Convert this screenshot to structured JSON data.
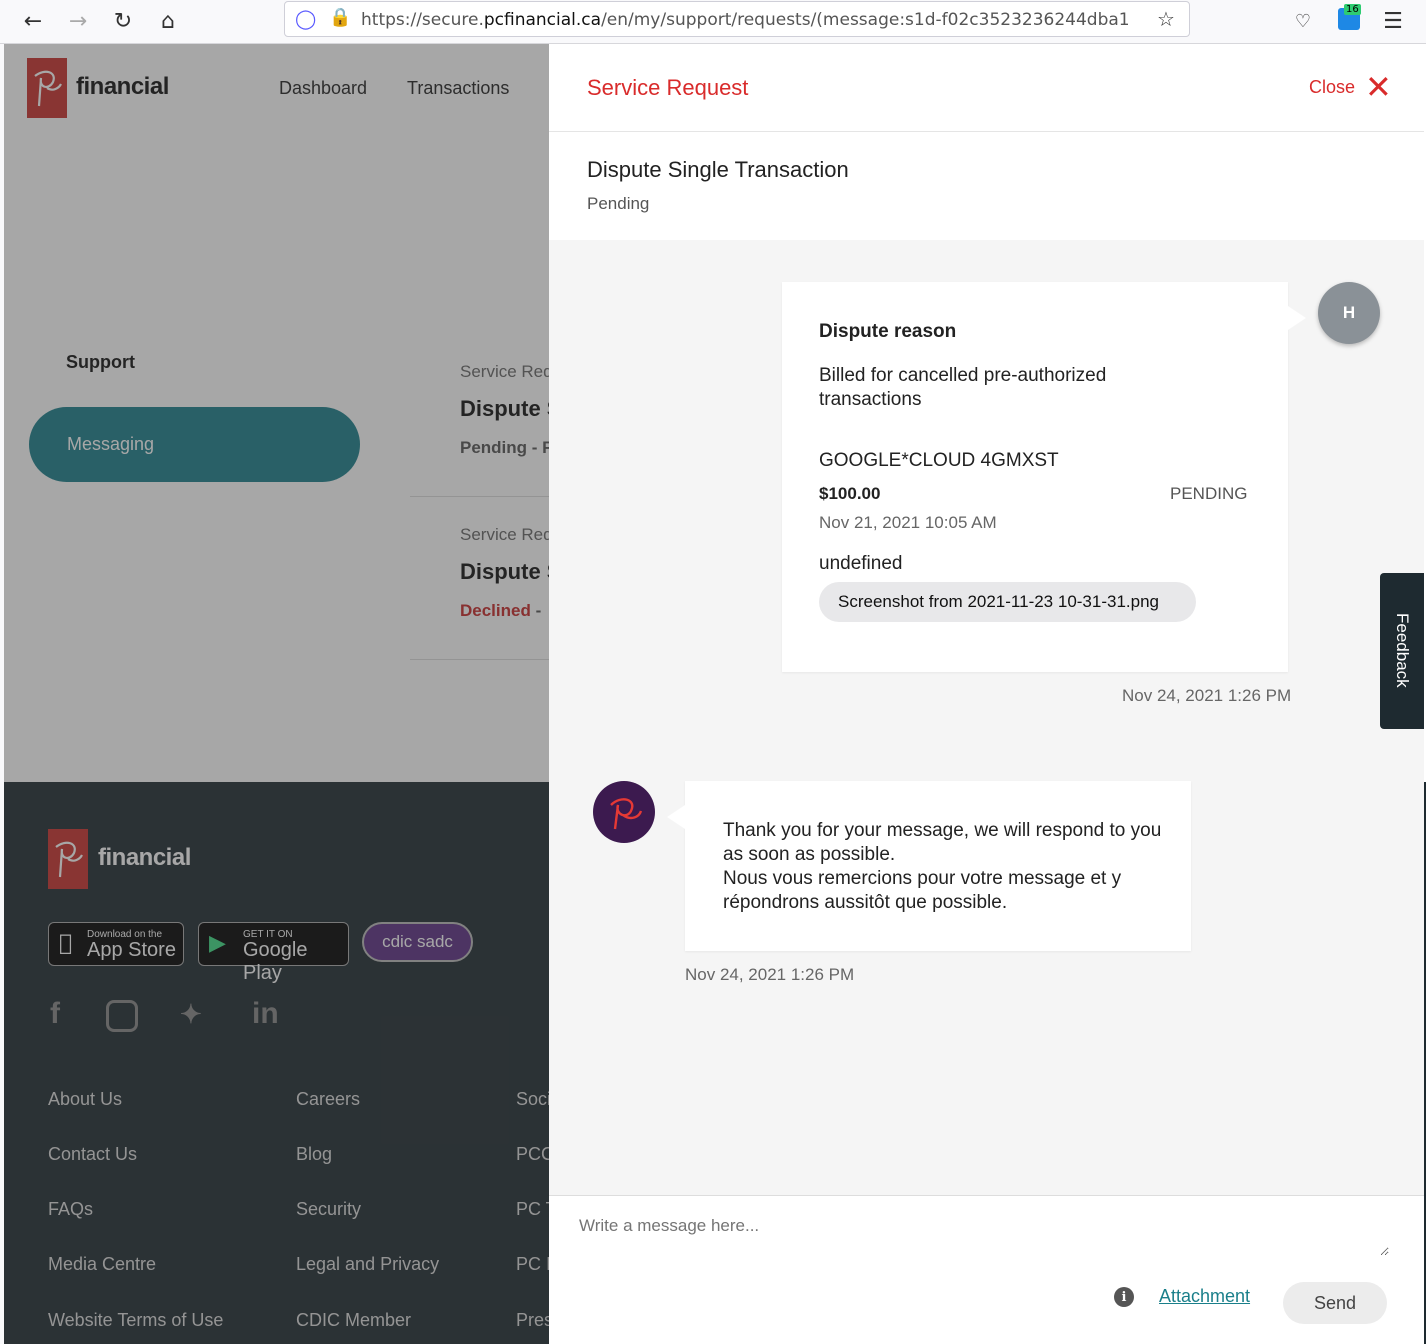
{
  "browser": {
    "url_prefix": "https://secure.",
    "url_domain": "pcfinancial.ca",
    "url_path": "/en/my/support/requests/(message:s1d-f02c3523236244dba1",
    "extension_badge": "16"
  },
  "site": {
    "brand": "financial",
    "nav": {
      "dashboard": "Dashboard",
      "transactions": "Transactions"
    },
    "sidebar": {
      "support": "Support",
      "messaging": "Messaging"
    },
    "requests": [
      {
        "type": "Service Req",
        "title": "Dispute S",
        "status": "Pending - F"
      },
      {
        "type": "Service Req",
        "title": "Dispute S",
        "status": "Declined",
        "status_rest": " -"
      }
    ],
    "footer": {
      "brand": "financial",
      "app_store_small": "Download on the",
      "app_store_big": "App Store",
      "google_small": "GET IT ON",
      "google_big": "Google Play",
      "cdic": "cdic sadc",
      "col1": [
        "About Us",
        "Contact Us",
        "FAQs",
        "Media Centre",
        "Website Terms of Use"
      ],
      "col2": [
        "Careers",
        "Blog",
        "Security",
        "Legal and Privacy",
        "CDIC Member"
      ],
      "col3": [
        "Soci",
        "PCC",
        "PC T",
        "PC I",
        "Pres"
      ]
    }
  },
  "panel": {
    "title": "Service Request",
    "close_label": "Close",
    "request_title": "Dispute Single Transaction",
    "request_status": "Pending",
    "user_message": {
      "avatar_initial": "H",
      "heading": "Dispute reason",
      "reason": "Billed for cancelled pre-authorized transactions",
      "merchant": "GOOGLE*CLOUD 4GMXST",
      "amount": "$100.00",
      "status": "PENDING",
      "date": "Nov 21, 2021 10:05 AM",
      "note": "undefined",
      "attachment": "Screenshot from 2021-11-23 10-31-31.png",
      "timestamp": "Nov 24, 2021 1:26 PM"
    },
    "bank_message": {
      "line_en": "Thank you for your message, we will respond to you as soon as possible.",
      "line_fr": "Nous vous remercions pour votre message et y répondrons aussitôt que possible.",
      "timestamp": "Nov 24, 2021 1:26 PM"
    },
    "composer": {
      "placeholder": "Write a message here...",
      "attachment_label": "Attachment",
      "send_label": "Send"
    }
  },
  "feedback_label": "Feedback"
}
